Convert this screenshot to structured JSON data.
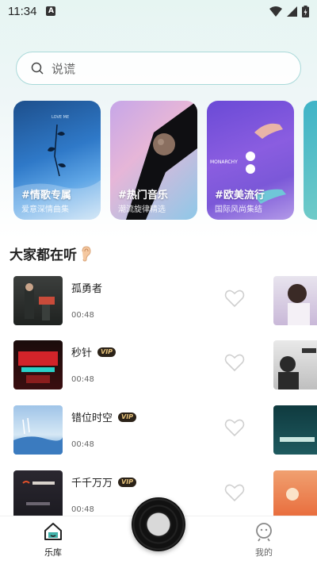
{
  "status": {
    "time": "11:34",
    "notif_letter": "A"
  },
  "search": {
    "placeholder": "说谎"
  },
  "cards": [
    {
      "title": "#情歌专属",
      "subtitle": "爱意深情曲集"
    },
    {
      "title": "#热门音乐",
      "subtitle": "潮流旋律精选"
    },
    {
      "title": "#欧美流行",
      "subtitle": "国际风尚集结"
    }
  ],
  "section": {
    "title": "大家都在听"
  },
  "songs": [
    {
      "name": "孤勇者",
      "duration": "00:48",
      "vip": false
    },
    {
      "name": "秒针",
      "duration": "00:48",
      "vip": true
    },
    {
      "name": "错位时空",
      "duration": "00:48",
      "vip": true
    },
    {
      "name": "千千万万",
      "duration": "00:48",
      "vip": true
    }
  ],
  "vip_label": "VIP",
  "nav": {
    "library": "乐库",
    "mine": "我的"
  },
  "colors": {
    "accent": "#1fa39a",
    "search_border": "#a9d9d9",
    "vip_bg": "#2b2218",
    "vip_text": "#e6c27a"
  }
}
